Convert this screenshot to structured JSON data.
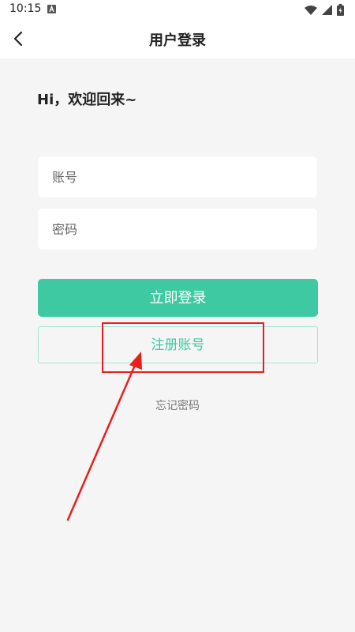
{
  "status_bar": {
    "time": "10:15",
    "icons": [
      "a-notification-icon",
      "wifi-icon",
      "signal-icon",
      "battery-icon"
    ]
  },
  "header": {
    "title": "用户登录",
    "back_icon": "chevron-left-icon"
  },
  "greeting": "Hi，欢迎回来~",
  "form": {
    "account_placeholder": "账号",
    "password_placeholder": "密码",
    "login_label": "立即登录",
    "register_label": "注册账号",
    "forgot_label": "忘记密码"
  },
  "colors": {
    "accent": "#3ec9a2",
    "annotation": "#e8201c",
    "background": "#f5f5f5"
  }
}
